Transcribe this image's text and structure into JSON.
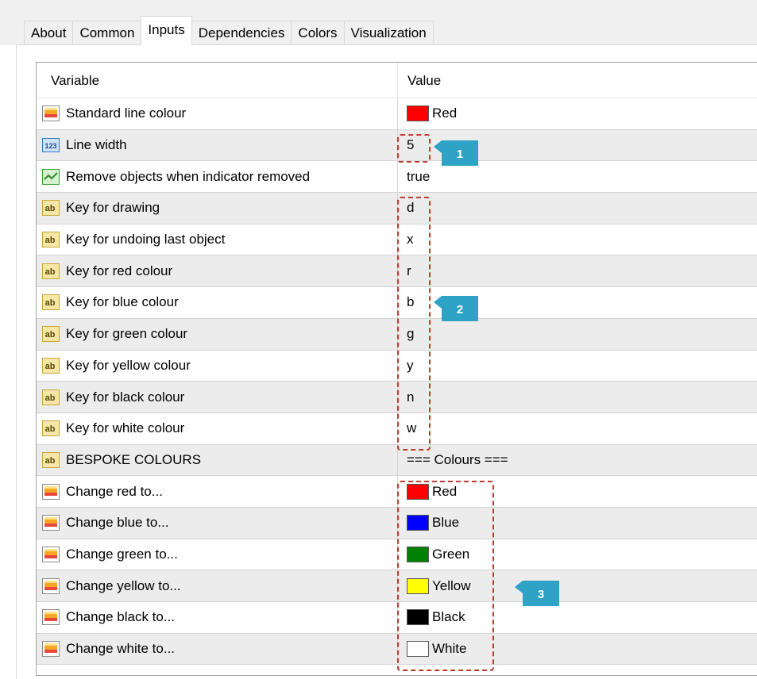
{
  "tabs": [
    {
      "label": "About"
    },
    {
      "label": "Common"
    },
    {
      "label": "Inputs",
      "active": true
    },
    {
      "label": "Dependencies"
    },
    {
      "label": "Colors"
    },
    {
      "label": "Visualization"
    }
  ],
  "grid": {
    "header": {
      "variable": "Variable",
      "value": "Value"
    },
    "rows": [
      {
        "icon": "color-icon",
        "variable": "Standard line colour",
        "value": "Red",
        "swatch": "#ff0000"
      },
      {
        "icon": "integer-icon",
        "variable": "Line width",
        "value": "5"
      },
      {
        "icon": "boolean-icon",
        "variable": "Remove objects when indicator removed",
        "value": "true"
      },
      {
        "icon": "string-icon",
        "variable": "Key for drawing",
        "value": "d"
      },
      {
        "icon": "string-icon",
        "variable": "Key for undoing last object",
        "value": "x"
      },
      {
        "icon": "string-icon",
        "variable": "Key for red colour",
        "value": "r"
      },
      {
        "icon": "string-icon",
        "variable": "Key for blue colour",
        "value": "b"
      },
      {
        "icon": "string-icon",
        "variable": "Key for green colour",
        "value": "g"
      },
      {
        "icon": "string-icon",
        "variable": "Key for yellow colour",
        "value": "y"
      },
      {
        "icon": "string-icon",
        "variable": "Key for black colour",
        "value": "n"
      },
      {
        "icon": "string-icon",
        "variable": "Key for white colour",
        "value": "w"
      },
      {
        "icon": "string-icon",
        "variable": "BESPOKE COLOURS",
        "value": "=== Colours ==="
      },
      {
        "icon": "color-icon",
        "variable": "Change red to...",
        "value": "Red",
        "swatch": "#ff0000"
      },
      {
        "icon": "color-icon",
        "variable": "Change blue to...",
        "value": "Blue",
        "swatch": "#0000ff"
      },
      {
        "icon": "color-icon",
        "variable": "Change green to...",
        "value": "Green",
        "swatch": "#008000"
      },
      {
        "icon": "color-icon",
        "variable": "Change yellow to...",
        "value": "Yellow",
        "swatch": "#ffff00"
      },
      {
        "icon": "color-icon",
        "variable": "Change black to...",
        "value": "Black",
        "swatch": "#000000"
      },
      {
        "icon": "color-icon",
        "variable": "Change white to...",
        "value": "White",
        "swatch": "#ffffff"
      }
    ]
  },
  "callouts": [
    {
      "label": "1"
    },
    {
      "label": "2"
    },
    {
      "label": "3"
    }
  ],
  "colors": {
    "callout": "#2fa3c6",
    "highlight": "#c0392b"
  }
}
